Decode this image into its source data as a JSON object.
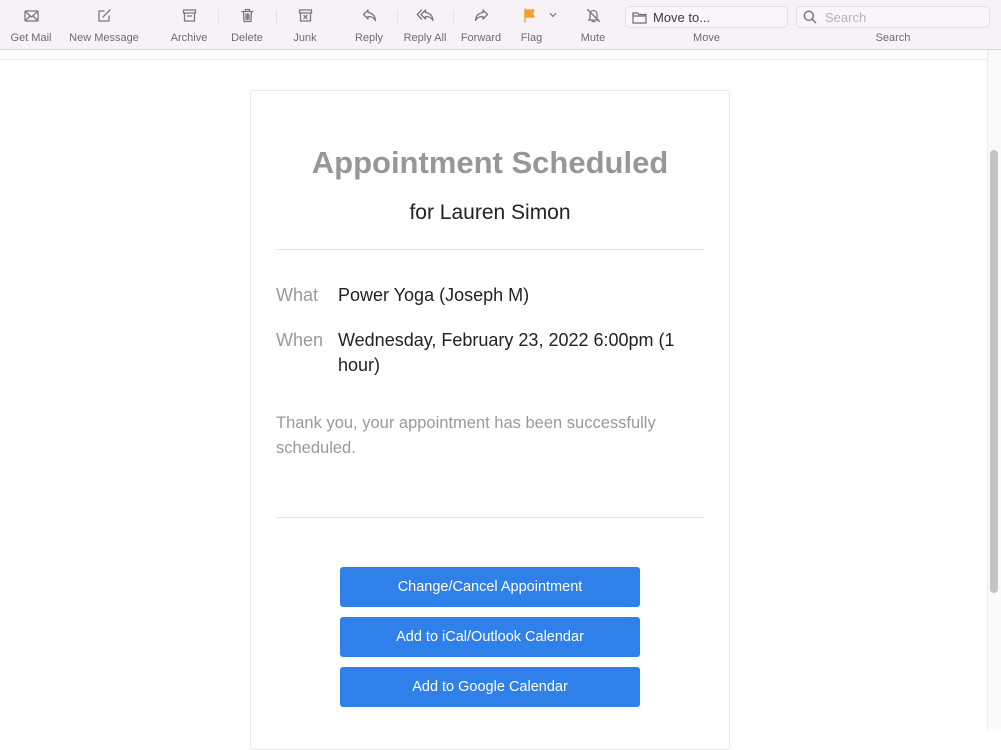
{
  "toolbar": {
    "items": [
      {
        "label": "Get Mail",
        "icon": "envelope-icon"
      },
      {
        "label": "New Message",
        "icon": "compose-icon"
      },
      {
        "label": "Archive",
        "icon": "archive-icon"
      },
      {
        "label": "Delete",
        "icon": "trash-icon"
      },
      {
        "label": "Junk",
        "icon": "junk-icon"
      },
      {
        "label": "Reply",
        "icon": "reply-icon"
      },
      {
        "label": "Reply All",
        "icon": "reply-all-icon"
      },
      {
        "label": "Forward",
        "icon": "forward-icon"
      },
      {
        "label": "Flag",
        "icon": "flag-icon"
      },
      {
        "label": "Mute",
        "icon": "bell-slash-icon"
      }
    ],
    "flag_color": "#f0a030",
    "move": {
      "button_label": "Move to...",
      "group_label": "Move"
    },
    "search": {
      "placeholder": "Search",
      "value": "",
      "group_label": "Search"
    }
  },
  "email": {
    "title": "Appointment Scheduled",
    "subtitle": "for Lauren Simon",
    "details": [
      {
        "label": "What",
        "value": "Power Yoga (Joseph M)"
      },
      {
        "label": "When",
        "value": "Wednesday, February 23, 2022 6:00pm (1 hour)"
      }
    ],
    "note": "Thank you, your appointment has been successfully scheduled.",
    "buttons": [
      {
        "label": "Change/Cancel Appointment"
      },
      {
        "label": "Add to iCal/Outlook Calendar"
      },
      {
        "label": "Add to Google Calendar"
      }
    ],
    "button_color": "#2f80e8"
  }
}
